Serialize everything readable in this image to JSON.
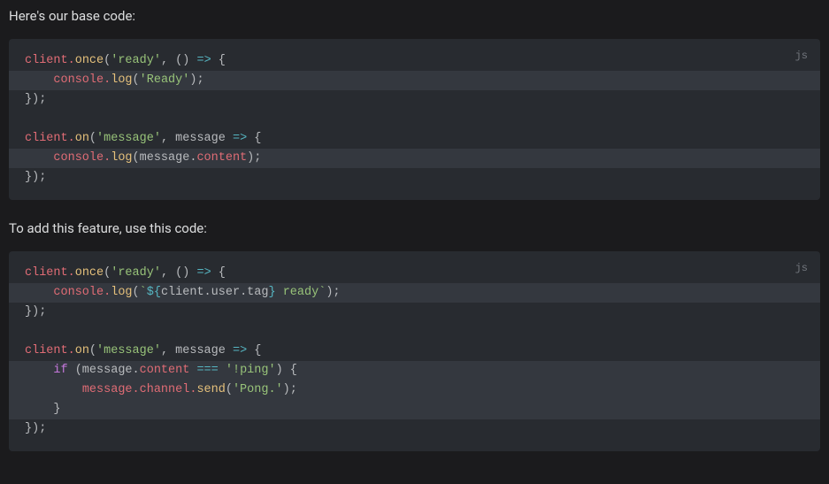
{
  "intro1": "Here's our base code:",
  "intro2": "To add this feature, use this code:",
  "lang": "js",
  "block1": {
    "l1": {
      "a": "client.",
      "b": "once",
      "c": "(",
      "d": "'ready'",
      "e": ", () ",
      "f": "=>",
      "g": " {"
    },
    "l2": {
      "indent": "    ",
      "a": "console.",
      "b": "log",
      "c": "(",
      "d": "'Ready'",
      "e": ");"
    },
    "l3": {
      "a": "});"
    },
    "l5": {
      "a": "client.",
      "b": "on",
      "c": "(",
      "d": "'message'",
      "e": ", message ",
      "f": "=>",
      "g": " {"
    },
    "l6": {
      "indent": "    ",
      "a": "console.",
      "b": "log",
      "c": "(message.",
      "d": "content",
      "e": ");"
    },
    "l7": {
      "a": "});"
    }
  },
  "block2": {
    "l1": {
      "a": "client.",
      "b": "once",
      "c": "(",
      "d": "'ready'",
      "e": ", () ",
      "f": "=>",
      "g": " {"
    },
    "l2": {
      "indent": "    ",
      "a": "console.",
      "b": "log",
      "c": "(",
      "d": "`",
      "e": "${",
      "f": "client.user.tag",
      "g": "}",
      "h": " ready",
      "i": "`",
      "j": ");"
    },
    "l3": {
      "a": "});"
    },
    "l5": {
      "a": "client.",
      "b": "on",
      "c": "(",
      "d": "'message'",
      "e": ", message ",
      "f": "=>",
      "g": " {"
    },
    "l6": {
      "indent": "    ",
      "a": "if",
      "b": " (message.",
      "c": "content",
      "d": " ",
      "e": "===",
      "f": " ",
      "g": "'!ping'",
      "h": ") {"
    },
    "l7": {
      "indent": "        ",
      "a": "message.channel.",
      "b": "send",
      "c": "(",
      "d": "'Pong.'",
      "e": ");"
    },
    "l8": {
      "indent": "    ",
      "a": "}"
    },
    "l9": {
      "a": "});"
    }
  }
}
